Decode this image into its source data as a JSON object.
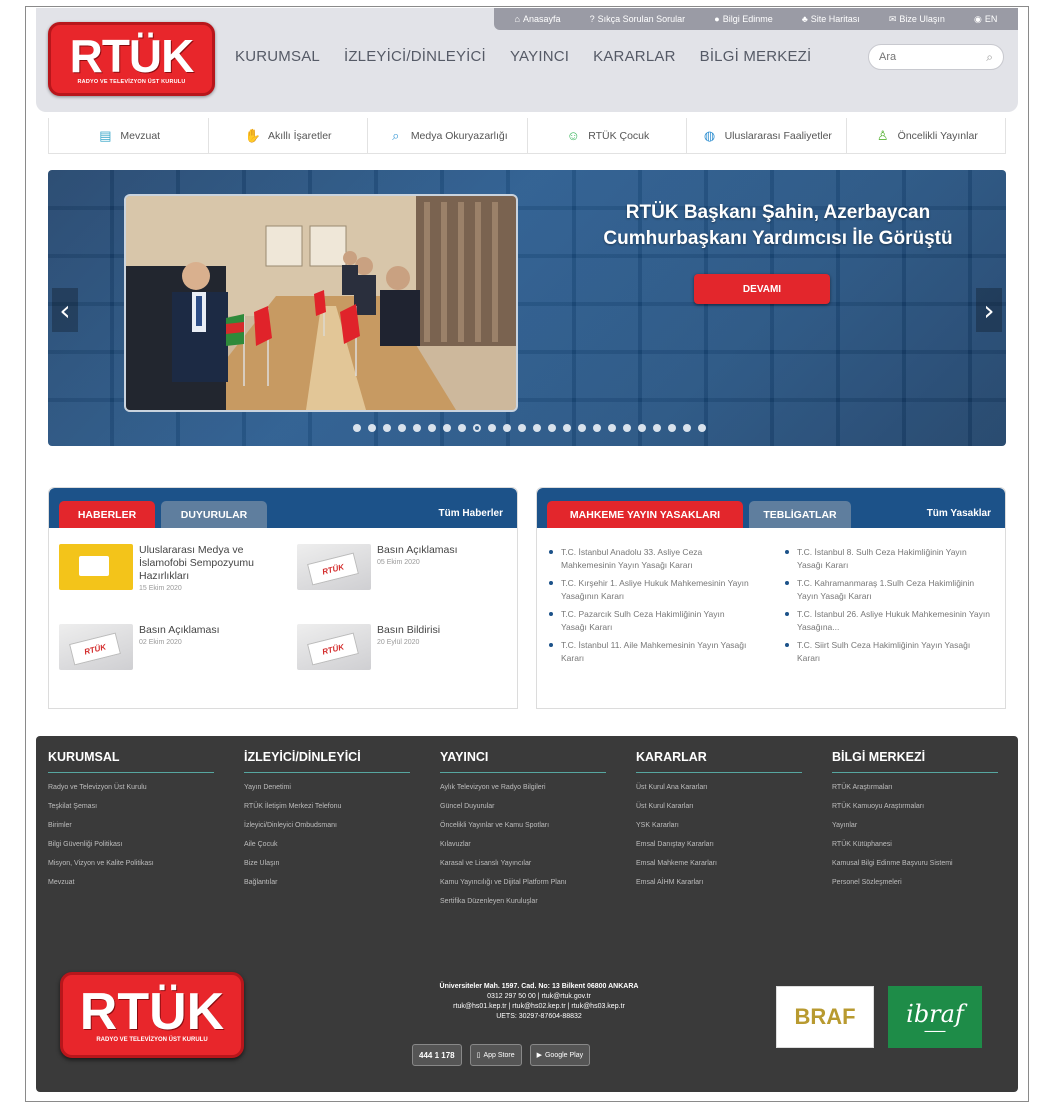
{
  "utility_links": [
    {
      "icon": "home-icon",
      "glyph": "⌂",
      "label": "Anasayfa"
    },
    {
      "icon": "question-icon",
      "glyph": "?",
      "label": "Sıkça Sorulan Sorular"
    },
    {
      "icon": "info-icon",
      "glyph": "●",
      "label": "Bilgi Edinme"
    },
    {
      "icon": "sitemap-icon",
      "glyph": "♣",
      "label": "Site Haritası"
    },
    {
      "icon": "mail-icon",
      "glyph": "✉",
      "label": "Bize Ulaşın"
    },
    {
      "icon": "globe-icon",
      "glyph": "◉",
      "label": "EN"
    }
  ],
  "logo": {
    "text": "RTÜK",
    "subtitle": "RADYO VE TELEVİZYON ÜST KURULU"
  },
  "main_nav": [
    "KURUMSAL",
    "İZLEYİCİ/DİNLEYİCİ",
    "YAYINCI",
    "KARARLAR",
    "BİLGİ MERKEZİ"
  ],
  "search": {
    "placeholder": "Ara"
  },
  "quick_links": [
    {
      "label": "Mevzuat",
      "icon": "document-icon",
      "glyph": "▤",
      "color": "#3aa7c9"
    },
    {
      "label": "Akıllı İşaretler",
      "icon": "person-icon",
      "glyph": "✋",
      "color": "#2b7bd6"
    },
    {
      "label": "Medya Okuryazarlığı",
      "icon": "magnifier-icon",
      "glyph": "⌕",
      "color": "#3c9ad6"
    },
    {
      "label": "RTÜK Çocuk",
      "icon": "child-icon",
      "glyph": "☺",
      "color": "#3cb65f"
    },
    {
      "label": "Uluslararası Faaliyetler",
      "icon": "globe-icon",
      "glyph": "◍",
      "color": "#2f8fd0"
    },
    {
      "label": "Öncelikli Yayınlar",
      "icon": "figure-icon",
      "glyph": "♙",
      "color": "#58b336"
    }
  ],
  "hero": {
    "title": "RTÜK Başkanı Şahin, Azerbaycan Cumhurbaşkanı Yardımcısı İle Görüştü",
    "button": "DEVAMI",
    "slides": 24,
    "active_slide": 9
  },
  "news_panel": {
    "tabs": [
      "HABERLER",
      "DUYURULAR"
    ],
    "all_link": "Tüm Haberler",
    "items": [
      {
        "title": "Uluslararası Medya ve İslamofobi Sempozyumu Hazırlıkları",
        "date": "15 Ekim 2020",
        "thumb": "yellow"
      },
      {
        "title": "Basın Açıklaması",
        "date": "05 Ekim 2020",
        "thumb": "rtuk"
      },
      {
        "title": "Basın Açıklaması",
        "date": "02 Ekim 2020",
        "thumb": "rtuk"
      },
      {
        "title": "Basın Bildirisi",
        "date": "20 Eylül 2020",
        "thumb": "rtuk"
      }
    ]
  },
  "ban_panel": {
    "tabs": [
      "MAHKEME YAYIN YASAKLARI",
      "TEBLİGATLAR"
    ],
    "all_link": "Tüm Yasaklar",
    "left": [
      "T.C. İstanbul Anadolu 33. Asliye Ceza Mahkemesinin Yayın Yasağı Kararı",
      "T.C. Kırşehir 1. Asliye Hukuk Mahkemesinin Yayın Yasağının Kararı",
      "T.C. Pazarcık Sulh Ceza Hakimliğinin Yayın Yasağı Kararı",
      "T.C. İstanbul 11. Aile Mahkemesinin Yayın Yasağı Kararı"
    ],
    "right": [
      "T.C. İstanbul 8. Sulh Ceza Hakimliğinin Yayın Yasağı Kararı",
      "T.C. Kahramanmaraş 1.Sulh Ceza Hakimliğinin Yayın Yasağı Kararı",
      "T.C. İstanbul 26. Asliye Hukuk Mahkemesinin Yayın Yasağına...",
      "T.C. Siirt Sulh Ceza Hakimliğinin Yayın Yasağı Kararı"
    ]
  },
  "footer": {
    "columns": [
      {
        "title": "KURUMSAL",
        "links": [
          "Radyo ve Televizyon Üst Kurulu",
          "Teşkilat Şeması",
          "Birimler",
          "Bilgi Güvenliği Politikası",
          "Misyon, Vizyon ve Kalite Politikası",
          "Mevzuat"
        ]
      },
      {
        "title": "İZLEYİCİ/DİNLEYİCİ",
        "links": [
          "Yayın Denetimi",
          "RTÜK İletişim Merkezi Telefonu",
          "İzleyici/Dinleyici Ombudsmanı",
          "Aile Çocuk",
          "Bize Ulaşın",
          "Bağlantılar"
        ]
      },
      {
        "title": "YAYINCI",
        "links": [
          "Aylık Televizyon ve Radyo Bilgileri",
          "Güncel Duyurular",
          "Öncelikli Yayınlar ve Kamu Spotları",
          "Kılavuzlar",
          "Karasal ve Lisanslı Yayıncılar",
          "Kamu Yayıncılığı ve Dijital Platform Planı",
          "Sertifika Düzenleyen Kuruluşlar"
        ]
      },
      {
        "title": "KARARLAR",
        "links": [
          "Üst Kurul Ana Kararları",
          "Üst Kurul Kararları",
          "YSK Kararları",
          "Emsal Danıştay Kararları",
          "Emsal Mahkeme Kararları",
          "Emsal AİHM Kararları"
        ]
      },
      {
        "title": "BİLGİ MERKEZİ",
        "links": [
          "RTÜK Araştırmaları",
          "RTÜK Kamuoyu Araştırmaları",
          "Yayınlar",
          "RTÜK Kütüphanesi",
          "Kamusal Bilgi Edinme Başvuru Sistemi",
          "Personel Sözleşmeleri"
        ]
      }
    ],
    "address": [
      "Üniversiteler Mah. 1597. Cad. No: 13 Bilkent 06800 ANKARA",
      "0312 297 50 00 | rtuk@rtuk.gov.tr",
      "rtuk@hs01.kep.tr | rtuk@hs02.kep.tr | rtuk@hs03.kep.tr",
      "UETS: 30297-87604-88832"
    ],
    "phone": "444 1 178",
    "app_store": "App Store",
    "google_play": "Google Play",
    "partner1": "BRAF",
    "partner2": "ibraf"
  }
}
